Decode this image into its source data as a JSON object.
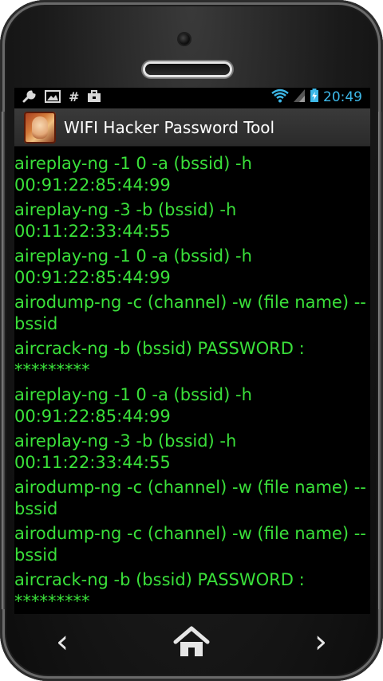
{
  "status_bar": {
    "left_icons": [
      "wrench-icon",
      "image-icon",
      "hash-icon",
      "briefcase-icon"
    ],
    "right_icons": [
      "wifi-icon",
      "signal-icon",
      "battery-icon"
    ],
    "time": "20:49",
    "accent_color": "#3db8e8"
  },
  "app": {
    "title": "WIFI Hacker Password Tool"
  },
  "content": {
    "text_color": "#3ae03a",
    "lines": [
      "aireplay-ng -1 0 -a (bssid) -h 00:91:22:85:44:99",
      "aireplay-ng -3 -b (bssid) -h 00:11:22:33:44:55",
      "aireplay-ng -1 0 -a (bssid) -h 00:91:22:85:44:99",
      "airodump-ng -c (channel) -w (file name) --bssid",
      "aircrack-ng -b (bssid) PASSWORD : *********",
      "aireplay-ng -1 0 -a (bssid) -h 00:91:22:85:44:99",
      "aireplay-ng -3 -b (bssid) -h 00:11:22:33:44:55",
      "airodump-ng -c (channel) -w (file name) --bssid",
      "airodump-ng -c (channel) -w (file name) --bssid",
      "aircrack-ng -b (bssid) PASSWORD : *********"
    ]
  },
  "nav": {
    "back_glyph": "‹",
    "forward_glyph": "›"
  }
}
